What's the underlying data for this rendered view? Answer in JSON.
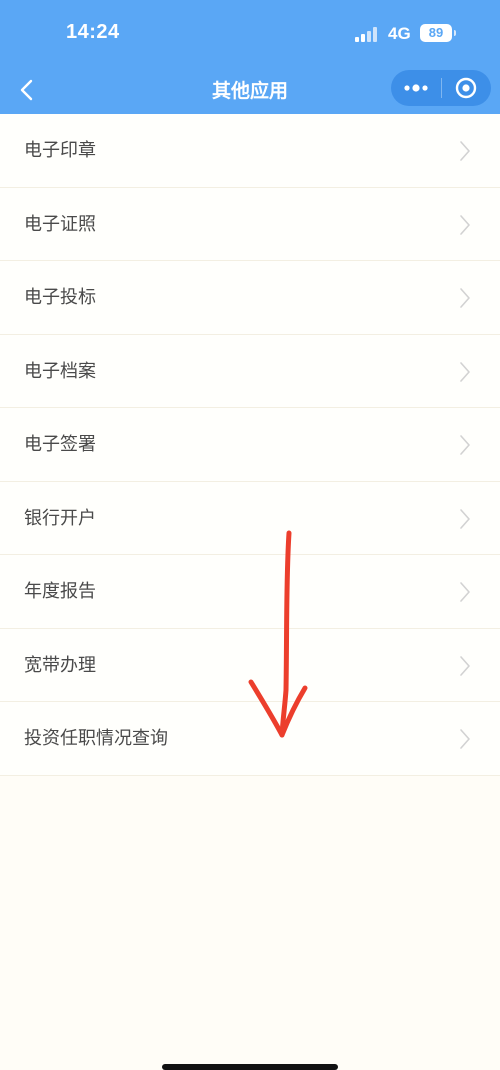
{
  "status_bar": {
    "time": "14:24",
    "network": "4G",
    "battery": "89"
  },
  "nav": {
    "title": "其他应用",
    "back_icon": "chevron-left-icon",
    "more_icon": "more-dots-icon",
    "close_icon": "target-close-icon"
  },
  "menu": {
    "items": [
      {
        "label": "电子印章"
      },
      {
        "label": "电子证照"
      },
      {
        "label": "电子投标"
      },
      {
        "label": "电子档案"
      },
      {
        "label": "电子签署"
      },
      {
        "label": "银行开户"
      },
      {
        "label": "年度报告"
      },
      {
        "label": "宽带办理"
      },
      {
        "label": "投资任职情况查询"
      }
    ]
  },
  "colors": {
    "header_bg": "#5aa7f5",
    "capsule_bg": "#3d8fe8",
    "page_bg": "#fffdf7",
    "annotation_arrow": "#ec3e2c"
  }
}
